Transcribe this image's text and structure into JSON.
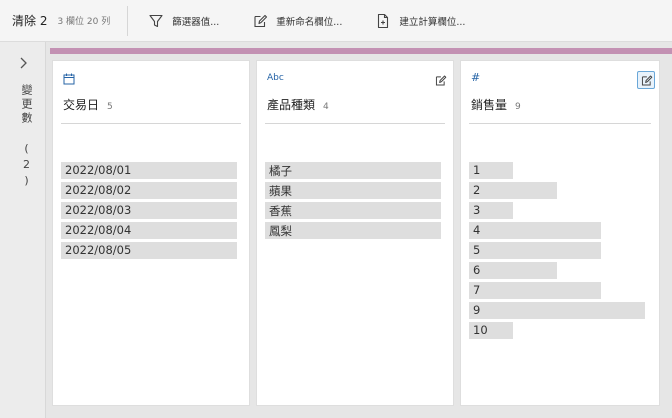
{
  "toolbar": {
    "title": "清除 2",
    "meta": "3 欄位  20 列",
    "actions": [
      {
        "label": "篩選器值...",
        "icon": "filter-icon"
      },
      {
        "label": "重新命名欄位...",
        "icon": "rename-icon"
      },
      {
        "label": "建立計算欄位...",
        "icon": "calc-field-icon"
      }
    ]
  },
  "changes_panel": {
    "label": "變更數 (2)",
    "icon": "chevron-right-icon"
  },
  "colors": {
    "accent": "#c391b3",
    "type_icon": "#2563a6",
    "bar": "#dedede"
  },
  "fields": [
    {
      "name": "交易日",
      "count": "5",
      "type": "date",
      "type_label": "",
      "values": [
        {
          "label": "2022/08/01",
          "frequency": 1
        },
        {
          "label": "2022/08/02",
          "frequency": 1
        },
        {
          "label": "2022/08/03",
          "frequency": 1
        },
        {
          "label": "2022/08/04",
          "frequency": 1
        },
        {
          "label": "2022/08/05",
          "frequency": 1
        }
      ]
    },
    {
      "name": "產品種類",
      "count": "4",
      "type": "string",
      "type_label": "Abc",
      "values": [
        {
          "label": "橘子",
          "frequency": 1
        },
        {
          "label": "蘋果",
          "frequency": 1
        },
        {
          "label": "香蕉",
          "frequency": 1
        },
        {
          "label": "鳳梨",
          "frequency": 1
        }
      ]
    },
    {
      "name": "銷售量",
      "count": "9",
      "type": "number",
      "type_label": "#",
      "values": [
        {
          "label": "1",
          "frequency": 1
        },
        {
          "label": "2",
          "frequency": 2
        },
        {
          "label": "3",
          "frequency": 1
        },
        {
          "label": "4",
          "frequency": 3
        },
        {
          "label": "5",
          "frequency": 3
        },
        {
          "label": "6",
          "frequency": 2
        },
        {
          "label": "7",
          "frequency": 3
        },
        {
          "label": "9",
          "frequency": 4
        },
        {
          "label": "10",
          "frequency": 1
        }
      ]
    }
  ]
}
